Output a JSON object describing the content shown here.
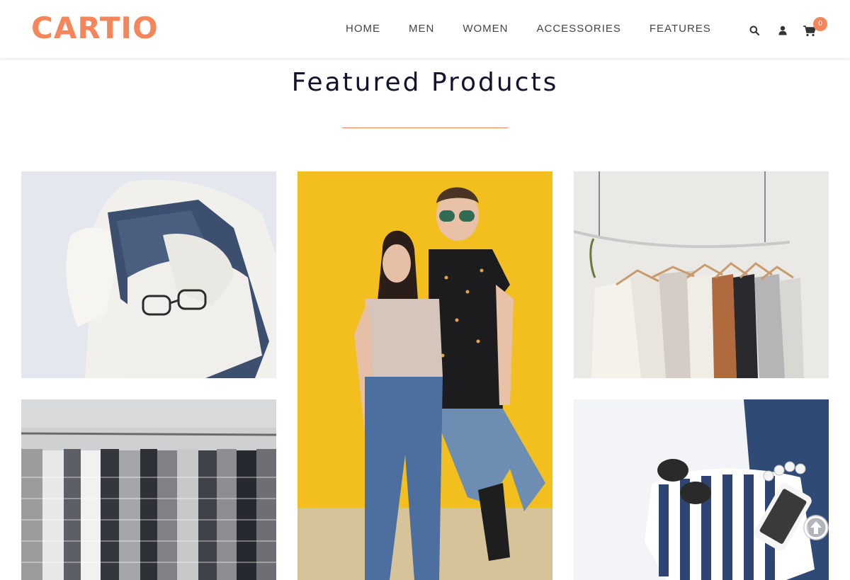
{
  "brand": {
    "logo": "CARTIO",
    "accent_color": "#f5855b",
    "title_color": "#14132e"
  },
  "nav": {
    "items": [
      "HOME",
      "MEN",
      "WOMEN",
      "ACCESSORIES",
      "FEATURES"
    ]
  },
  "header_icons": {
    "search": "search-icon",
    "user": "user-icon",
    "cart": "cart-icon",
    "cart_count": "0"
  },
  "section": {
    "title": "Featured Products"
  },
  "products": [
    {
      "icon": "jeans-sweater-glasses-image"
    },
    {
      "icon": "couple-yellow-wall-image"
    },
    {
      "icon": "blouses-on-hangers-image"
    },
    {
      "icon": "striped-shirts-rack-image"
    },
    {
      "icon": "striped-top-phone-sunglasses-image"
    }
  ],
  "scroll_top": {
    "icon": "arrow-up-icon"
  }
}
